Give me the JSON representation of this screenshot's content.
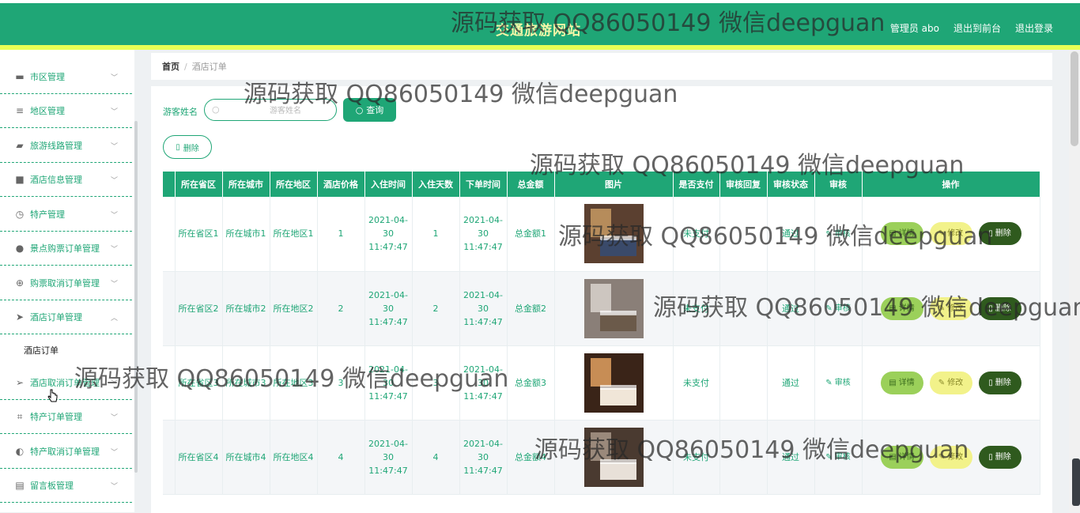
{
  "header": {
    "site_title": "交通旅游网站",
    "nav": [
      "管理员 abo",
      "退出到前台",
      "退出登录"
    ]
  },
  "sidebar": {
    "items": [
      {
        "icon": "laptop-icon",
        "glyph": "▬",
        "label": "市区管理",
        "expanded": false
      },
      {
        "icon": "sliders-icon",
        "glyph": "≡",
        "label": "地区管理",
        "expanded": false
      },
      {
        "icon": "ticket-icon",
        "glyph": "▰",
        "label": "旅游线路管理",
        "expanded": false
      },
      {
        "icon": "chat-icon",
        "glyph": "■",
        "label": "酒店信息管理",
        "expanded": false
      },
      {
        "icon": "clock-icon",
        "glyph": "◷",
        "label": "特产管理",
        "expanded": false
      },
      {
        "icon": "user-icon",
        "glyph": "●",
        "label": "景点购票订单管理",
        "expanded": false
      },
      {
        "icon": "crosshair-icon",
        "glyph": "⊕",
        "label": "购票取消订单管理",
        "expanded": false
      },
      {
        "icon": "send-icon",
        "glyph": "➤",
        "label": "酒店订单管理",
        "expanded": true
      },
      {
        "icon": "navigation-icon",
        "glyph": "➢",
        "label": "酒店取消订单管理",
        "expanded": false
      },
      {
        "icon": "crop-icon",
        "glyph": "⌗",
        "label": "特产订单管理",
        "expanded": false
      },
      {
        "icon": "compass-icon",
        "glyph": "◐",
        "label": "特产取消订单管理",
        "expanded": false
      },
      {
        "icon": "message-board-icon",
        "glyph": "▤",
        "label": "留言板管理",
        "expanded": false
      }
    ],
    "sub_item": "酒店订单"
  },
  "breadcrumb": {
    "home": "首页",
    "separator": "/",
    "current": "酒店订单"
  },
  "search": {
    "label": "游客姓名",
    "placeholder": "游客姓名",
    "value": "",
    "button": "查询"
  },
  "actions": {
    "delete_label": "删除"
  },
  "table": {
    "columns": [
      "所在省区",
      "所在城市",
      "所在地区",
      "酒店价格",
      "入住时间",
      "入住天数",
      "下单时间",
      "总金额",
      "图片",
      "是否支付",
      "审核回复",
      "审核状态",
      "审核",
      "操作"
    ],
    "rows": [
      {
        "province": "所在省区1",
        "city": "所在城市1",
        "district": "所在地区1",
        "price": "1",
        "checkin": "2021-04-30 11:47:47",
        "days": "1",
        "order_time": "2021-04-30 11:47:47",
        "total": "总金额1",
        "paid": "未支付",
        "reply": "",
        "status": "通过",
        "audit": "审核"
      },
      {
        "province": "所在省区2",
        "city": "所在城市2",
        "district": "所在地区2",
        "price": "2",
        "checkin": "2021-04-30 11:47:47",
        "days": "2",
        "order_time": "2021-04-30 11:47:47",
        "total": "总金额2",
        "paid": "未支付",
        "reply": "",
        "status": "通过",
        "audit": "审核"
      },
      {
        "province": "所在省区3",
        "city": "所在城市3",
        "district": "所在地区3",
        "price": "3",
        "checkin": "2021-04-30 11:47:47",
        "days": "3",
        "order_time": "2021-04-30 11:47:47",
        "total": "总金额3",
        "paid": "未支付",
        "reply": "",
        "status": "通过",
        "audit": "审核"
      },
      {
        "province": "所在省区4",
        "city": "所在城市4",
        "district": "所在地区4",
        "price": "4",
        "checkin": "2021-04-30 11:47:47",
        "days": "4",
        "order_time": "2021-04-30 11:47:47",
        "total": "总金额4",
        "paid": "未支付",
        "reply": "",
        "status": "通过",
        "audit": "审核"
      }
    ],
    "op_labels": {
      "detail": "详情",
      "edit": "修改",
      "delete": "删除"
    }
  },
  "watermark_text": "源码获取 QQ86050149 微信deepguan",
  "colors": {
    "primary": "#1fa676",
    "accent_yellow": "#e8ff55",
    "detail_btn": "#9bd05a",
    "edit_btn": "#f2f28a",
    "delete_btn": "#2f5a1e"
  }
}
